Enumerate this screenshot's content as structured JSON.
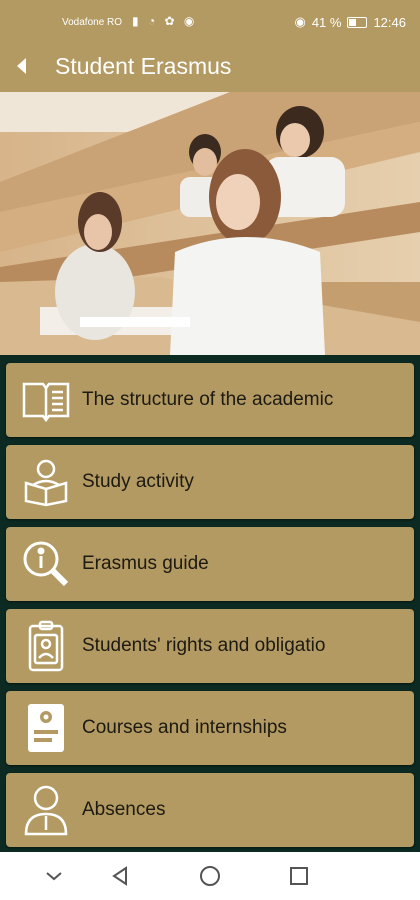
{
  "status_bar": {
    "carrier": "Vodafone RO",
    "battery": "41 %",
    "time": "12:46"
  },
  "header": {
    "title": "Student Erasmus",
    "back_icon": "back-arrow-icon"
  },
  "hero": {
    "image": "students-in-lecture-hall-photo"
  },
  "menu": {
    "items": [
      {
        "label": "The structure of the academic",
        "icon": "open-book-icon"
      },
      {
        "label": "Study activity",
        "icon": "student-reading-icon"
      },
      {
        "label": "Erasmus guide",
        "icon": "info-magnifier-icon"
      },
      {
        "label": "Students' rights and obligatio",
        "icon": "badge-clipboard-icon"
      },
      {
        "label": "Courses and internships",
        "icon": "settings-document-icon"
      },
      {
        "label": "Absences",
        "icon": "person-icon"
      }
    ]
  },
  "nav_bar": {
    "icons": [
      "chevron-down-icon",
      "back-triangle-icon",
      "home-circle-icon",
      "recents-square-icon"
    ]
  },
  "colors": {
    "gold": "#b39a62",
    "background": "#0c2a22",
    "text": "#1d1a12"
  }
}
